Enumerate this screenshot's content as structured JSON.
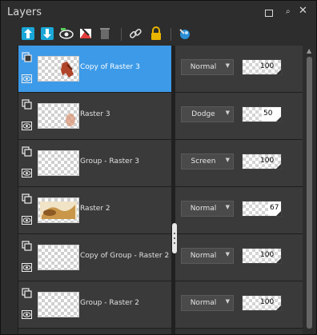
{
  "panel": {
    "title": "Layers"
  },
  "toolbar": {
    "icons": [
      "new-raster-layer-icon",
      "new-vector-layer-icon",
      "new-adjustment-layer-icon",
      "new-mask-layer-icon",
      "delete-layer-icon",
      "link-icon",
      "lock-icon",
      "layer-properties-icon"
    ]
  },
  "layers": [
    {
      "name": "Copy of Raster 3",
      "blend": "Normal",
      "opacity": "100",
      "selected": true
    },
    {
      "name": "Raster 3",
      "blend": "Dodge",
      "opacity": "50",
      "selected": false
    },
    {
      "name": "Group - Raster 3",
      "blend": "Screen",
      "opacity": "100",
      "selected": false
    },
    {
      "name": "Raster 2",
      "blend": "Normal",
      "opacity": "67",
      "selected": false
    },
    {
      "name": "Copy of Group - Raster 2",
      "blend": "Normal",
      "opacity": "100",
      "selected": false
    },
    {
      "name": "Group - Raster 2",
      "blend": "Normal",
      "opacity": "100",
      "selected": false
    }
  ],
  "colors": {
    "selection": "#3d9ae8",
    "panel_bg": "#2d2d2d",
    "row_bg": "#3a3a3a"
  }
}
